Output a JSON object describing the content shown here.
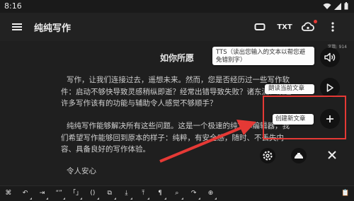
{
  "status_bar": {
    "time": "8:16"
  },
  "app_bar": {
    "title": "纯纯写作",
    "txt_label": "TXT"
  },
  "document": {
    "title": "如你所愿",
    "paragraphs": [
      "写作，让我们连接过去，遥想未来。然而，您是否经历过一些写作软件：启动不够快导致灵感稍纵即逝？经常出错导致失败？诸东流？缺乏许多写作该有的功能与辅助令人感觉不够顺手？",
      "纯纯写作能够解决所有这些问题。这是一个极速的纯文本编辑器，我们希望写作能够回到原本的样子：纯粹，有安全感，随时、不丢失内容、具备良好的写作体验。",
      "令人安心"
    ],
    "word_count_label": "字数: 914"
  },
  "tooltips": {
    "tts": "TTS（读出您输入的文本以帮您避免错别字）",
    "read_current": "朗读当前文章",
    "new_article": "创建新文章"
  },
  "colors": {
    "background": "#1f1f1f",
    "highlight": "#e53935",
    "fab": "#121212"
  },
  "toolbar": {
    "items": [
      {
        "icon": "command-icon",
        "glyph": "⌘"
      },
      {
        "icon": "undo-icon",
        "glyph": "↶"
      },
      {
        "icon": "indent-icon",
        "glyph": "⇥"
      },
      {
        "icon": "quote-icon",
        "glyph": "“”"
      },
      {
        "icon": "bracket-icon",
        "glyph": "「」"
      },
      {
        "icon": "paren-icon",
        "glyph": "()"
      },
      {
        "icon": "copy-icon",
        "glyph": "⧉"
      },
      {
        "icon": "move-down-icon",
        "glyph": "⤓"
      },
      {
        "icon": "move-up-icon",
        "glyph": "⤒"
      },
      {
        "icon": "format-icon",
        "glyph": "¶"
      },
      {
        "icon": "search-icon",
        "glyph": "⌕"
      },
      {
        "icon": "redo-icon",
        "glyph": "↷"
      },
      {
        "icon": "add-icon",
        "glyph": "⊕"
      },
      {
        "icon": "blank-1",
        "glyph": ""
      },
      {
        "icon": "blank-2",
        "glyph": ""
      },
      {
        "icon": "blank-3",
        "glyph": ""
      },
      {
        "icon": "blank-4",
        "glyph": ""
      },
      {
        "icon": "blank-5",
        "glyph": ""
      },
      {
        "icon": "blank-6",
        "glyph": ""
      },
      {
        "icon": "blank-7",
        "glyph": ""
      },
      {
        "icon": "clipboard-icon",
        "glyph": "📋"
      }
    ]
  }
}
